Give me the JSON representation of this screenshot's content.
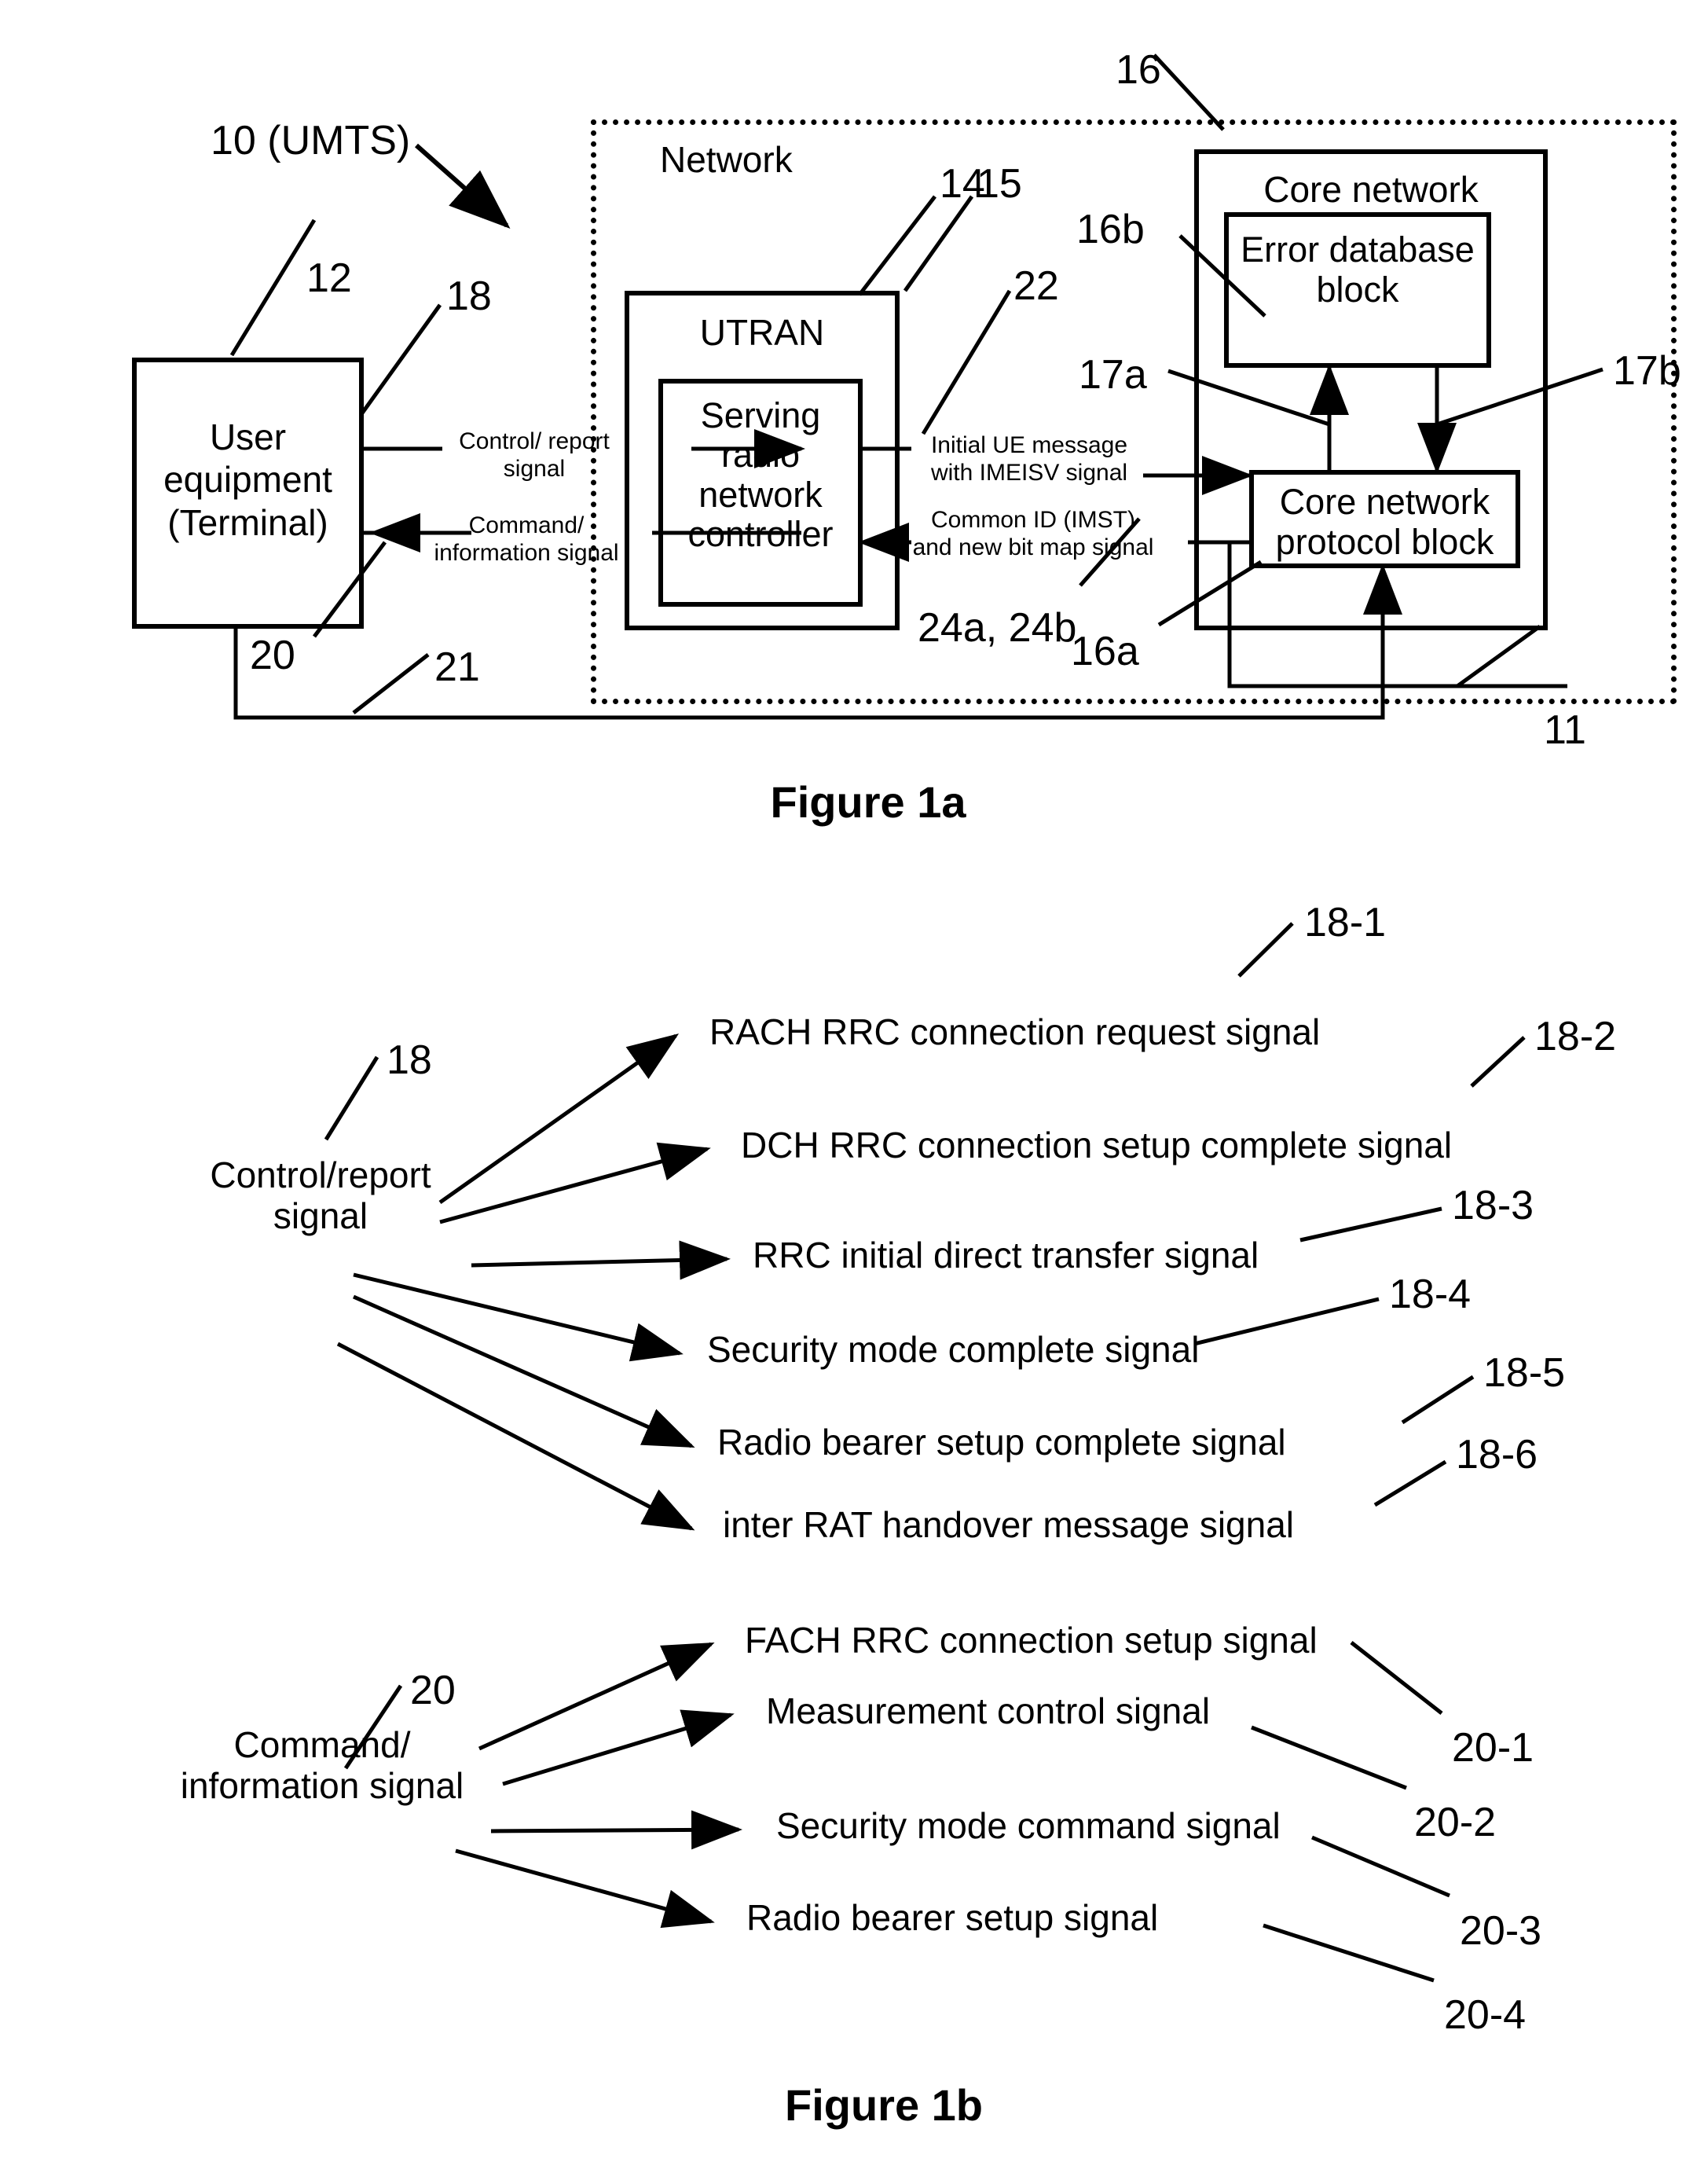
{
  "figure_1a": {
    "caption": "Figure 1a",
    "system_label": "10 (UMTS)",
    "network_label": "Network",
    "blocks": {
      "user_equipment": {
        "label": "User\nequipment\n(Terminal)",
        "ref": "12"
      },
      "utran": {
        "label": "UTRAN",
        "ref": "14"
      },
      "srnc": {
        "label": "Serving\nradio\nnetwork\ncontroller",
        "ref": "15"
      },
      "core_network": {
        "label": "Core network",
        "ref": "16"
      },
      "error_database": {
        "label": "Error\ndatabase\nblock",
        "ref": "16b"
      },
      "core_protocol": {
        "label": "Core network\nprotocol block",
        "ref": "16a"
      }
    },
    "signals": {
      "control_report": {
        "label": "Control/ report\nsignal",
        "ref": "18"
      },
      "command_information": {
        "label": "Command/\ninformation signal",
        "ref": "20"
      },
      "initial_ue": {
        "label": "Initial UE message\nwith IMEISV signal",
        "ref": "22"
      },
      "common_id": {
        "label": "Common ID (IMST)\nand new bit map signal",
        "ref": "24a, 24b"
      },
      "db_write": {
        "ref": "17a"
      },
      "db_read": {
        "ref": "17b"
      },
      "ue_feedback": {
        "ref": "21"
      },
      "network_feedback": {
        "ref": "11"
      }
    }
  },
  "figure_1b": {
    "caption": "Figure 1b",
    "group_control": {
      "source_label": "Control/report\nsignal",
      "source_ref": "18",
      "items": [
        {
          "label": "RACH RRC connection request signal",
          "ref": "18-1"
        },
        {
          "label": "DCH RRC connection setup complete signal",
          "ref": "18-2"
        },
        {
          "label": "RRC initial direct transfer signal",
          "ref": "18-3"
        },
        {
          "label": "Security mode complete signal",
          "ref": "18-4"
        },
        {
          "label": "Radio bearer setup complete signal",
          "ref": "18-5"
        },
        {
          "label": "inter RAT handover message signal",
          "ref": "18-6"
        }
      ]
    },
    "group_command": {
      "source_label": "Command/\ninformation signal",
      "source_ref": "20",
      "items": [
        {
          "label": "FACH RRC connection setup signal",
          "ref": "20-1"
        },
        {
          "label": "Measurement control signal",
          "ref": "20-2"
        },
        {
          "label": "Security mode command signal",
          "ref": "20-3"
        },
        {
          "label": "Radio bearer setup signal",
          "ref": "20-4"
        }
      ]
    }
  },
  "colors": {
    "ink": "#000000",
    "paper": "#ffffff"
  }
}
